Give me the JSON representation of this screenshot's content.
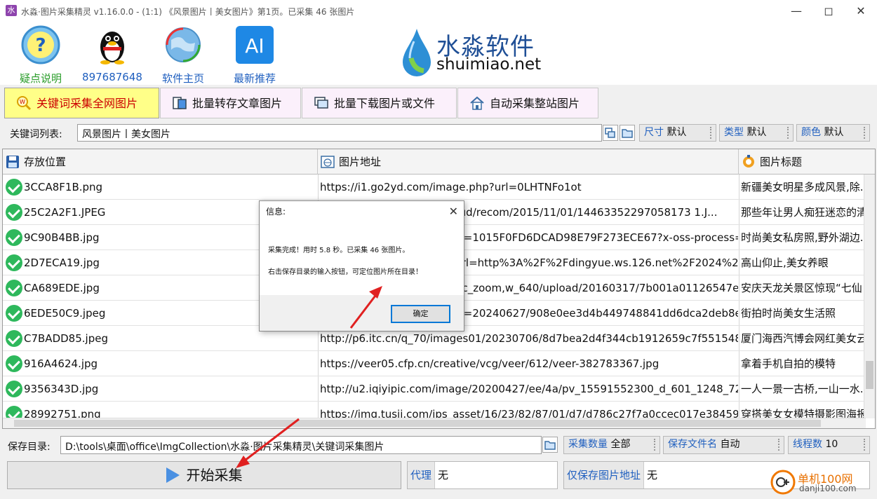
{
  "window": {
    "title": "水淼·图片采集精灵 v1.16.0.0 - (1:1) 《风景图片丨美女图片》第1页。已采集 46 张图片",
    "controls": [
      "minimize",
      "maximize",
      "close"
    ]
  },
  "header": {
    "items": [
      {
        "icon": "question-icon",
        "label": "疑点说明",
        "color": "#2a9d2a"
      },
      {
        "icon": "qq-penguin-icon",
        "label": "897687648",
        "color": "#1f5fbf"
      },
      {
        "icon": "globe-icon",
        "label": "软件主页",
        "color": "#1f5fbf"
      },
      {
        "icon": "ai-icon",
        "label": "最新推荐",
        "color": "#1f5fbf"
      }
    ],
    "brand_cn": "水淼软件",
    "brand_en": "shuimiao.net"
  },
  "tabs": [
    {
      "label": "关键词采集全网图片",
      "icon": "search-w-icon",
      "active": true
    },
    {
      "label": "批量转存文章图片",
      "icon": "transfer-icon",
      "active": false
    },
    {
      "label": "批量下载图片或文件",
      "icon": "download-window-icon",
      "active": false
    },
    {
      "label": "自动采集整站图片",
      "icon": "home-icon",
      "active": false
    }
  ],
  "keyword_row": {
    "label": "关键词列表:",
    "value": "风景图片丨美女图片",
    "options": [
      {
        "key": "尺寸",
        "value": "默认"
      },
      {
        "key": "类型",
        "value": "默认"
      },
      {
        "key": "颜色",
        "value": "默认"
      }
    ]
  },
  "table": {
    "columns": [
      "存放位置",
      "图片地址",
      "图片标题"
    ],
    "rows": [
      {
        "file": "3CCA8F1B.png",
        "url": "https://i1.go2yd.com/image.php?url=0LHTNFo1ot",
        "title": "新疆美女明星多成风景,除..."
      },
      {
        "file": "25C2A2F1.JPEG",
        "url": "http://pic1.win4000.ncccloud/recom/2015/11/01/14463352297058173 1.J...",
        "title": "那些年让男人痴狂迷恋的清"
      },
      {
        "file": "9C90B4BB.jpg",
        "url": "https://img0.baidu.com/it/u=1015F0FD6DCAD98E79F273ECE67?x-oss-process=i...",
        "title": "时尚美女私房照,野外湖边..."
      },
      {
        "file": "2D7ECA19.jpg",
        "url": "https://nimg.ws.126.net/?url=http%3A%2F%2Fdingyue.ws.126.net%2F2024%2F...",
        "title": "高山仰止,美女养眼"
      },
      {
        "file": "CA689EDE.jpg",
        "url": "https://img.mp.itc.cn/q_70,c_zoom,w_640/upload/20160317/7b001a01126547e...",
        "title": "安庆天龙关景区惊现“七仙"
      },
      {
        "file": "6EDE50C9.jpeg",
        "url": "https://img2.baidu.com/it/u=20240627/908e0ee3d4b449748841dd6dca2deb8e.j...",
        "title": "街拍时尚美女生活照"
      },
      {
        "file": "C7BADD85.jpeg",
        "url": "http://p6.itc.cn/q_70/images01/20230706/8d7bea2d4f344cb1912659c7f551548...",
        "title": "厦门海西汽博会网红美女云"
      },
      {
        "file": "916A4624.jpg",
        "url": "https://veer05.cfp.cn/creative/vcg/veer/612/veer-382783367.jpg",
        "title": "拿着手机自拍的模特"
      },
      {
        "file": "9356343D.jpg",
        "url": "http://u2.iqiyipic.com/image/20200427/ee/4a/pv_15591552300_d_601_1248_72...",
        "title": "一人一景一古桥,一山一水..."
      },
      {
        "file": "28992751.png",
        "url": "https://img.tusij.com/ips_asset/16/23/82/87/01/d7/d786c27f7a0ccec017e38459...",
        "title": "穿搭美女女模特摄影图海报"
      }
    ]
  },
  "bottom": {
    "save_label": "保存目录:",
    "save_path": "D:\\tools\\桌面\\office\\ImgCollection\\水淼·图片采集精灵\\关键词采集图片",
    "count": {
      "key": "采集数量",
      "value": "全部"
    },
    "filename": {
      "key": "保存文件名",
      "value": "自动"
    },
    "threads": {
      "key": "线程数",
      "value": "10"
    },
    "start_label": "开始采集",
    "proxy": {
      "key": "代理",
      "value": "无"
    },
    "save_url_only": {
      "key": "仅保存图片地址",
      "value": "无"
    }
  },
  "dialog": {
    "title": "信息:",
    "line1": "采集完成！用时 5.8 秒。已采集 46 张图片。",
    "line2": "右击保存目录的输入按钮，可定位图片所在目录！",
    "ok_label": "确定"
  },
  "watermark": {
    "cn": "单机100网",
    "en": "danji100.com"
  },
  "colors": {
    "accent_blue": "#1f5fbf",
    "check_green": "#2eb85c",
    "active_tab": "#ffff88",
    "arrow_red": "#e02020"
  }
}
